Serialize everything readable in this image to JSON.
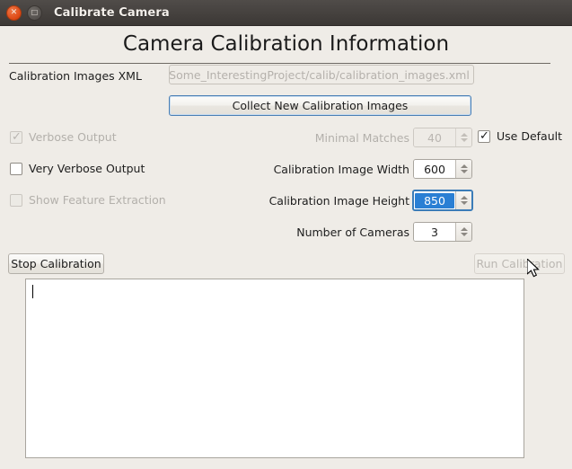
{
  "window": {
    "title": "Calibrate Camera",
    "close_glyph": "✕",
    "maximize_glyph": "□"
  },
  "header": {
    "page_title": "Camera Calibration Information"
  },
  "form": {
    "xml_label": "Calibration Images XML",
    "xml_value": "p/Some_InterestingProject/calib/calibration_images.xml",
    "collect_button": "Collect New Calibration Images"
  },
  "checkboxes": {
    "verbose": {
      "label": "Verbose Output",
      "checked": true,
      "enabled": false,
      "tick": "✓"
    },
    "very_verbose": {
      "label": "Very Verbose Output",
      "checked": false,
      "enabled": true,
      "tick": ""
    },
    "show_feature_extraction": {
      "label": "Show Feature Extraction",
      "checked": false,
      "enabled": false,
      "tick": ""
    },
    "use_default": {
      "label": "Use Default",
      "checked": true,
      "enabled": true,
      "tick": "✓"
    }
  },
  "spinboxes": {
    "minimal_matches": {
      "label": "Minimal Matches",
      "value": "40",
      "enabled": false,
      "focused": false
    },
    "image_width": {
      "label": "Calibration Image Width",
      "value": "600",
      "enabled": true,
      "focused": false
    },
    "image_height": {
      "label": "Calibration Image Height",
      "value": "850",
      "enabled": true,
      "focused": true,
      "selected": true
    },
    "number_of_cameras": {
      "label": "Number of Cameras",
      "value": "3",
      "enabled": true,
      "focused": false
    }
  },
  "actions": {
    "stop_calibration": "Stop Calibration",
    "run_calibration": "Run Calibration"
  },
  "log": {
    "content": ""
  },
  "colors": {
    "window_background": "#efece7",
    "titlebar": "#3c3835",
    "close_button": "#dd4814",
    "focus_blue": "#3b7cb8",
    "selection_blue": "#2a7fd4",
    "text": "#1d1d1d",
    "disabled_text": "#b3b0ab"
  }
}
